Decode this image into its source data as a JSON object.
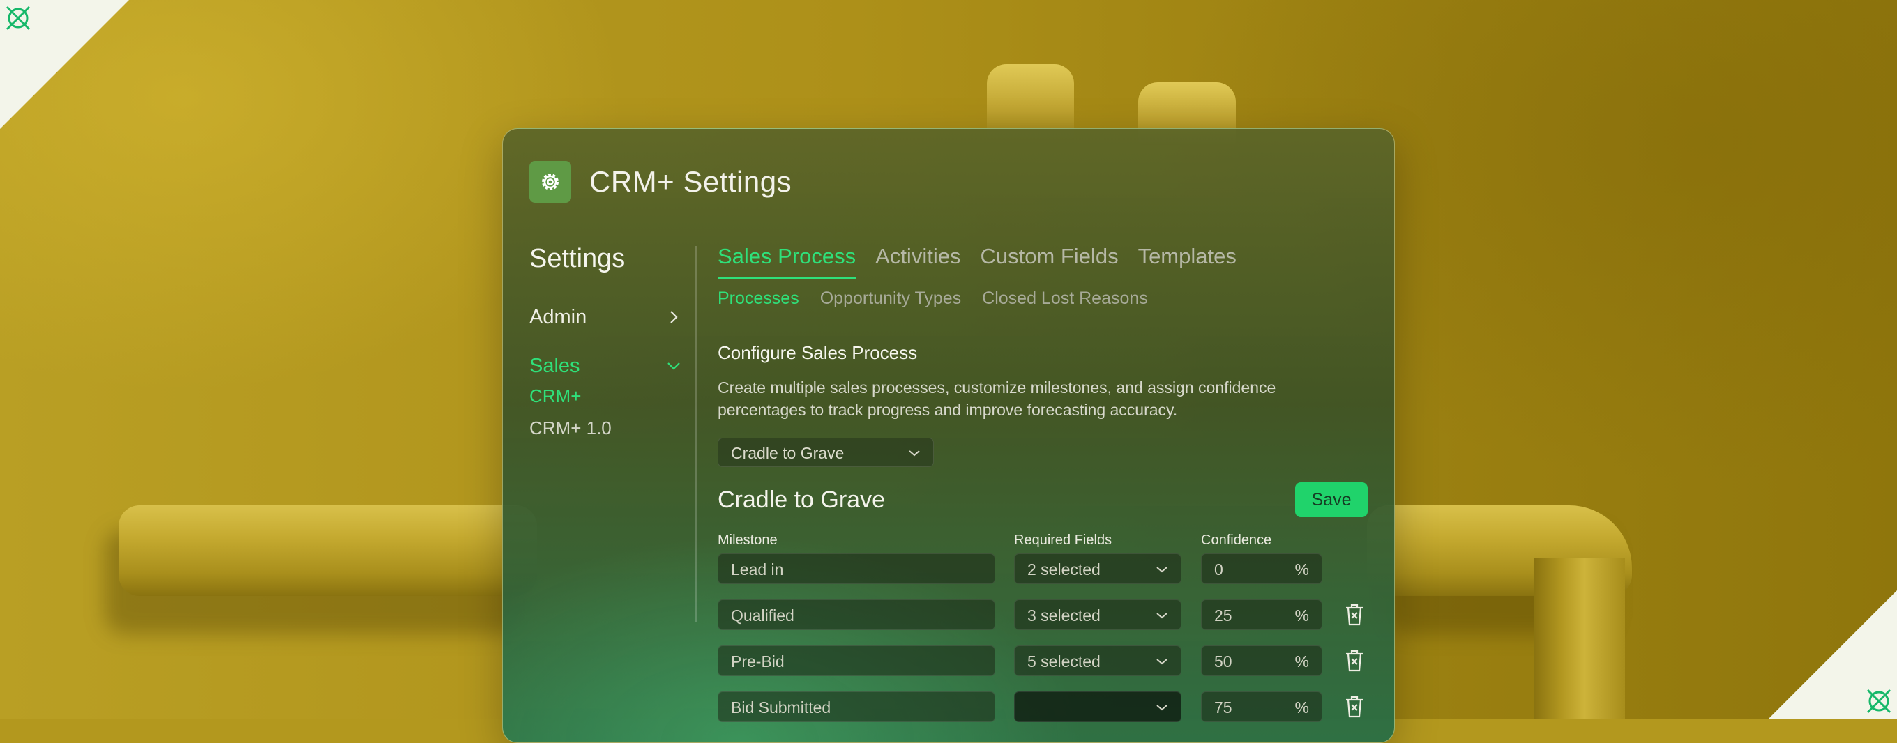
{
  "app": {
    "title": "CRM+ Settings",
    "logo_icon": "gear-icon"
  },
  "colors": {
    "accent": "#2fe07a",
    "save_button": "#20d36b"
  },
  "sidebar": {
    "title": "Settings",
    "admin": {
      "label": "Admin",
      "icon": "chevron-right-icon"
    },
    "sales": {
      "label": "Sales",
      "icon": "chevron-down-icon",
      "items": [
        {
          "label": "CRM+",
          "active": true
        },
        {
          "label": "CRM+ 1.0",
          "active": false
        }
      ]
    }
  },
  "tabs": [
    {
      "label": "Sales Process",
      "active": true
    },
    {
      "label": "Activities",
      "active": false
    },
    {
      "label": "Custom Fields",
      "active": false
    },
    {
      "label": "Templates",
      "active": false
    }
  ],
  "subtabs": [
    {
      "label": "Processes",
      "active": true
    },
    {
      "label": "Opportunity Types",
      "active": false
    },
    {
      "label": "Closed Lost Reasons",
      "active": false
    }
  ],
  "section": {
    "title": "Configure Sales Process",
    "description": "Create multiple sales processes, customize milestones, and assign confidence percentages to track progress and improve forecasting accuracy."
  },
  "process_select": {
    "value": "Cradle to Grave"
  },
  "process": {
    "title": "Cradle to Grave",
    "save_label": "Save"
  },
  "table": {
    "headers": {
      "milestone": "Milestone",
      "required": "Required Fields",
      "confidence": "Confidence"
    },
    "percent_symbol": "%",
    "rows": [
      {
        "milestone": "Lead in",
        "required": "2 selected",
        "confidence": "0",
        "deletable": false
      },
      {
        "milestone": "Qualified",
        "required": "3 selected",
        "confidence": "25",
        "deletable": true
      },
      {
        "milestone": "Pre-Bid",
        "required": "5 selected",
        "confidence": "50",
        "deletable": true
      },
      {
        "milestone": "Bid Submitted",
        "required": "",
        "confidence": "75",
        "deletable": true
      }
    ]
  }
}
